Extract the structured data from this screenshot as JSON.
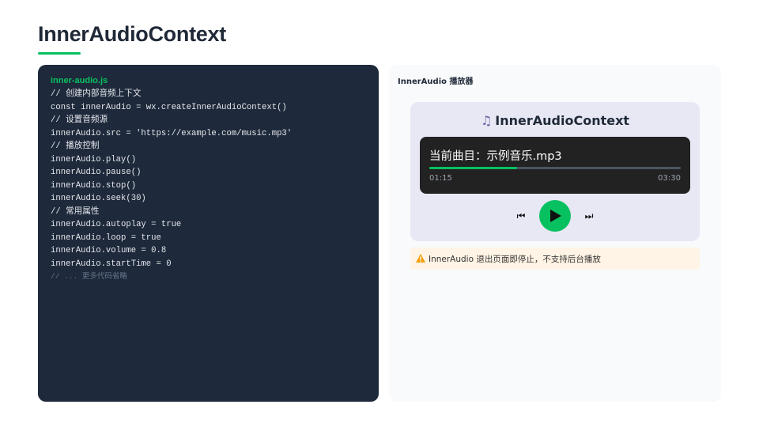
{
  "page": {
    "title": "InnerAudioContext"
  },
  "code": {
    "filename": "inner-audio.js",
    "lines": [
      "// 创建内部音频上下文",
      "const innerAudio = wx.createInnerAudioContext()",
      "// 设置音频源",
      "innerAudio.src = 'https://example.com/music.mp3'",
      "// 播放控制",
      "innerAudio.play()",
      "innerAudio.pause()",
      "innerAudio.stop()",
      "innerAudio.seek(30)",
      "// 常用属性",
      "innerAudio.autoplay = true",
      "innerAudio.loop = true",
      "innerAudio.volume = 0.8",
      "innerAudio.startTime = 0"
    ],
    "truncated_note": "// ... 更多代码省略"
  },
  "player": {
    "panel_title": "InnerAudio 播放器",
    "heading": "InnerAudioContext",
    "heading_icon": "music-note-icon",
    "track_line": "当前曲目：示例音乐.mp3",
    "current_time": "01:15",
    "total_time": "03:30",
    "progress_fraction": 0.35,
    "prev_icon": "⏮",
    "next_icon": "⏭",
    "warning": "InnerAudio 退出页面即停止，不支持后台播放"
  },
  "colors": {
    "accent": "#07c160",
    "code_bg": "#1e293b",
    "player_card_bg": "#e8e8f5",
    "now_playing_bg": "#222222",
    "warning_bg": "#fff4e5",
    "warning_icon": "#f59e0b"
  }
}
